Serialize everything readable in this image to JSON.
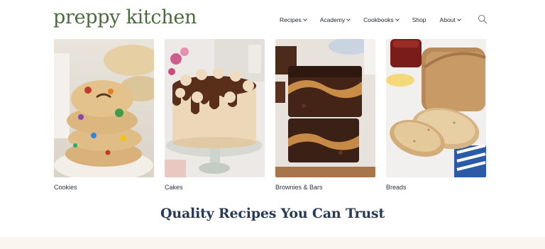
{
  "site": {
    "logo": "preppy kitchen"
  },
  "nav": {
    "items": [
      {
        "label": "Recipes",
        "dropdown": true
      },
      {
        "label": "Academy",
        "dropdown": true
      },
      {
        "label": "Cookbooks",
        "dropdown": true
      },
      {
        "label": "Shop",
        "dropdown": false
      },
      {
        "label": "About",
        "dropdown": true
      }
    ],
    "search_icon": "search-icon"
  },
  "categories": [
    {
      "label": "Cookies"
    },
    {
      "label": "Cakes"
    },
    {
      "label": "Brownies & Bars"
    },
    {
      "label": "Breads"
    }
  ],
  "heading": "Quality Recipes You Can Trust",
  "colors": {
    "logo": "#4b6b3e",
    "heading": "#283a55",
    "band": "#fbf5ef"
  }
}
